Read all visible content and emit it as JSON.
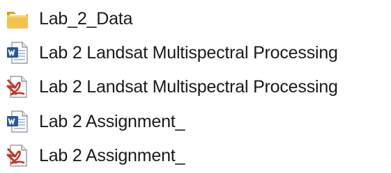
{
  "files": [
    {
      "name": "Lab_2_Data",
      "icon": "folder-icon"
    },
    {
      "name": "Lab 2  Landsat Multispectral Processing",
      "icon": "word-document-icon"
    },
    {
      "name": "Lab 2  Landsat Multispectral Processing",
      "icon": "pdf-document-icon"
    },
    {
      "name": "Lab 2 Assignment_",
      "icon": "word-document-icon"
    },
    {
      "name": "Lab 2 Assignment_",
      "icon": "pdf-document-icon"
    }
  ],
  "colors": {
    "folder": "#e8b23a",
    "word": "#2b5797",
    "pdf": "#c0392b"
  }
}
